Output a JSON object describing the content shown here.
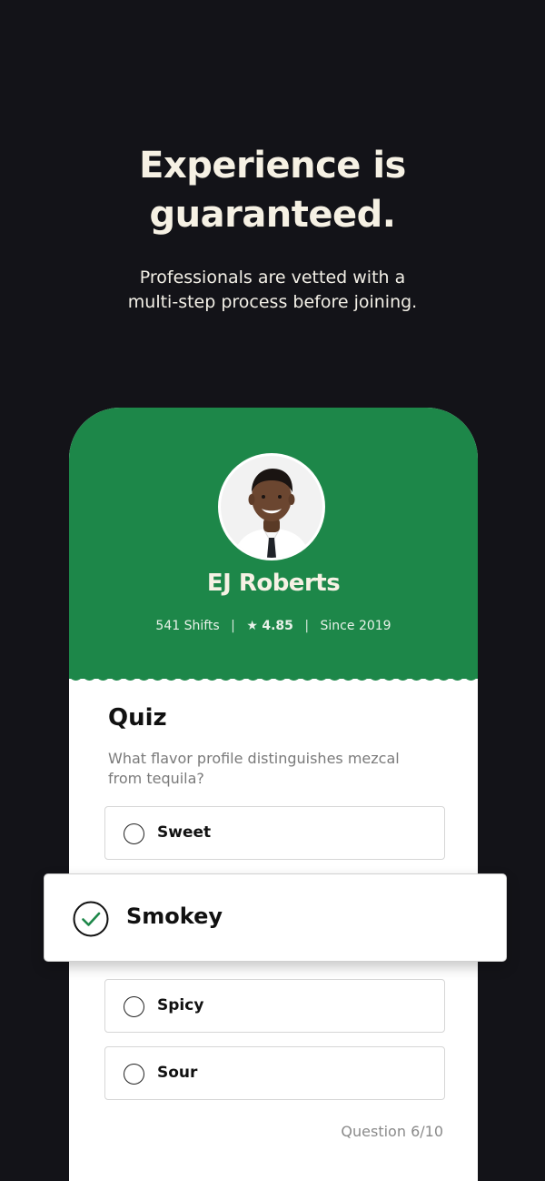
{
  "hero": {
    "headline_line1": "Experience is",
    "headline_line2": "guaranteed.",
    "subtitle_line1": "Professionals are vetted with a",
    "subtitle_line2": "multi-step process before joining."
  },
  "profile": {
    "name": "EJ Roberts",
    "shifts": "541 Shifts",
    "rating_star": "★",
    "rating": "4.85",
    "since": "Since 2019",
    "separator": "|"
  },
  "quiz": {
    "title": "Quiz",
    "question": "What flavor profile distinguishes mezcal from tequila?",
    "options": [
      {
        "label": "Sweet",
        "selected": false
      },
      {
        "label": "Smokey",
        "selected": true
      },
      {
        "label": "Spicy",
        "selected": false
      },
      {
        "label": "Sour",
        "selected": false
      }
    ],
    "progress": "Question 6/10"
  },
  "colors": {
    "background": "#131318",
    "brand_green": "#1d8749",
    "check_green": "#1d8749"
  },
  "icons": {
    "avatar": "profile-photo",
    "selected": "check-circle-icon",
    "unselected": "radio-circle-icon"
  }
}
